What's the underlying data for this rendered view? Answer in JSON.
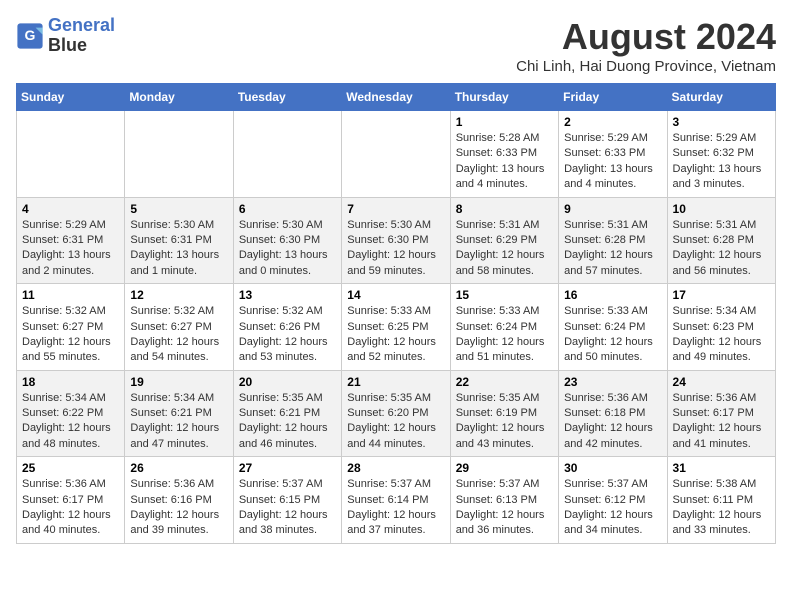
{
  "logo": {
    "line1": "General",
    "line2": "Blue"
  },
  "title": "August 2024",
  "location": "Chi Linh, Hai Duong Province, Vietnam",
  "days_of_week": [
    "Sunday",
    "Monday",
    "Tuesday",
    "Wednesday",
    "Thursday",
    "Friday",
    "Saturday"
  ],
  "weeks": [
    [
      {
        "day": "",
        "info": ""
      },
      {
        "day": "",
        "info": ""
      },
      {
        "day": "",
        "info": ""
      },
      {
        "day": "",
        "info": ""
      },
      {
        "day": "1",
        "info": "Sunrise: 5:28 AM\nSunset: 6:33 PM\nDaylight: 13 hours\nand 4 minutes."
      },
      {
        "day": "2",
        "info": "Sunrise: 5:29 AM\nSunset: 6:33 PM\nDaylight: 13 hours\nand 4 minutes."
      },
      {
        "day": "3",
        "info": "Sunrise: 5:29 AM\nSunset: 6:32 PM\nDaylight: 13 hours\nand 3 minutes."
      }
    ],
    [
      {
        "day": "4",
        "info": "Sunrise: 5:29 AM\nSunset: 6:31 PM\nDaylight: 13 hours\nand 2 minutes."
      },
      {
        "day": "5",
        "info": "Sunrise: 5:30 AM\nSunset: 6:31 PM\nDaylight: 13 hours\nand 1 minute."
      },
      {
        "day": "6",
        "info": "Sunrise: 5:30 AM\nSunset: 6:30 PM\nDaylight: 13 hours\nand 0 minutes."
      },
      {
        "day": "7",
        "info": "Sunrise: 5:30 AM\nSunset: 6:30 PM\nDaylight: 12 hours\nand 59 minutes."
      },
      {
        "day": "8",
        "info": "Sunrise: 5:31 AM\nSunset: 6:29 PM\nDaylight: 12 hours\nand 58 minutes."
      },
      {
        "day": "9",
        "info": "Sunrise: 5:31 AM\nSunset: 6:28 PM\nDaylight: 12 hours\nand 57 minutes."
      },
      {
        "day": "10",
        "info": "Sunrise: 5:31 AM\nSunset: 6:28 PM\nDaylight: 12 hours\nand 56 minutes."
      }
    ],
    [
      {
        "day": "11",
        "info": "Sunrise: 5:32 AM\nSunset: 6:27 PM\nDaylight: 12 hours\nand 55 minutes."
      },
      {
        "day": "12",
        "info": "Sunrise: 5:32 AM\nSunset: 6:27 PM\nDaylight: 12 hours\nand 54 minutes."
      },
      {
        "day": "13",
        "info": "Sunrise: 5:32 AM\nSunset: 6:26 PM\nDaylight: 12 hours\nand 53 minutes."
      },
      {
        "day": "14",
        "info": "Sunrise: 5:33 AM\nSunset: 6:25 PM\nDaylight: 12 hours\nand 52 minutes."
      },
      {
        "day": "15",
        "info": "Sunrise: 5:33 AM\nSunset: 6:24 PM\nDaylight: 12 hours\nand 51 minutes."
      },
      {
        "day": "16",
        "info": "Sunrise: 5:33 AM\nSunset: 6:24 PM\nDaylight: 12 hours\nand 50 minutes."
      },
      {
        "day": "17",
        "info": "Sunrise: 5:34 AM\nSunset: 6:23 PM\nDaylight: 12 hours\nand 49 minutes."
      }
    ],
    [
      {
        "day": "18",
        "info": "Sunrise: 5:34 AM\nSunset: 6:22 PM\nDaylight: 12 hours\nand 48 minutes."
      },
      {
        "day": "19",
        "info": "Sunrise: 5:34 AM\nSunset: 6:21 PM\nDaylight: 12 hours\nand 47 minutes."
      },
      {
        "day": "20",
        "info": "Sunrise: 5:35 AM\nSunset: 6:21 PM\nDaylight: 12 hours\nand 46 minutes."
      },
      {
        "day": "21",
        "info": "Sunrise: 5:35 AM\nSunset: 6:20 PM\nDaylight: 12 hours\nand 44 minutes."
      },
      {
        "day": "22",
        "info": "Sunrise: 5:35 AM\nSunset: 6:19 PM\nDaylight: 12 hours\nand 43 minutes."
      },
      {
        "day": "23",
        "info": "Sunrise: 5:36 AM\nSunset: 6:18 PM\nDaylight: 12 hours\nand 42 minutes."
      },
      {
        "day": "24",
        "info": "Sunrise: 5:36 AM\nSunset: 6:17 PM\nDaylight: 12 hours\nand 41 minutes."
      }
    ],
    [
      {
        "day": "25",
        "info": "Sunrise: 5:36 AM\nSunset: 6:17 PM\nDaylight: 12 hours\nand 40 minutes."
      },
      {
        "day": "26",
        "info": "Sunrise: 5:36 AM\nSunset: 6:16 PM\nDaylight: 12 hours\nand 39 minutes."
      },
      {
        "day": "27",
        "info": "Sunrise: 5:37 AM\nSunset: 6:15 PM\nDaylight: 12 hours\nand 38 minutes."
      },
      {
        "day": "28",
        "info": "Sunrise: 5:37 AM\nSunset: 6:14 PM\nDaylight: 12 hours\nand 37 minutes."
      },
      {
        "day": "29",
        "info": "Sunrise: 5:37 AM\nSunset: 6:13 PM\nDaylight: 12 hours\nand 36 minutes."
      },
      {
        "day": "30",
        "info": "Sunrise: 5:37 AM\nSunset: 6:12 PM\nDaylight: 12 hours\nand 34 minutes."
      },
      {
        "day": "31",
        "info": "Sunrise: 5:38 AM\nSunset: 6:11 PM\nDaylight: 12 hours\nand 33 minutes."
      }
    ]
  ]
}
